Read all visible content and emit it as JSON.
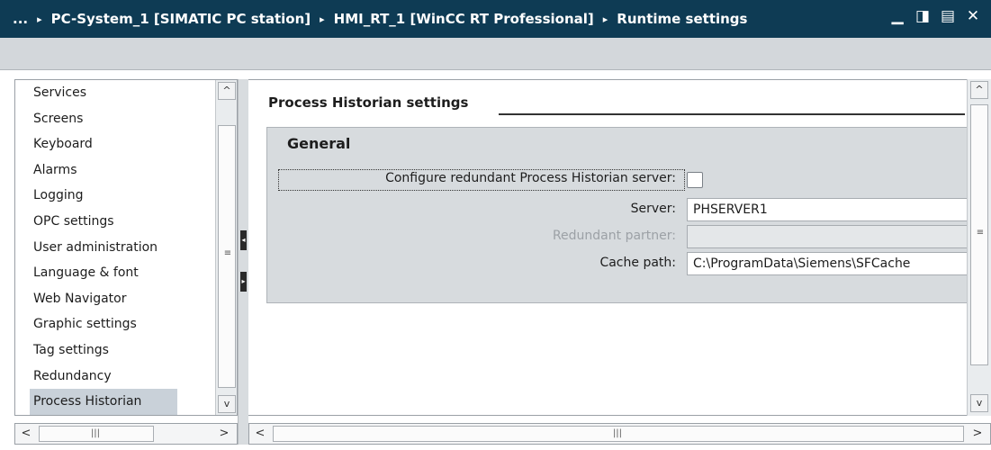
{
  "titlebar": {
    "prefix": "...",
    "crumbs": [
      "PC-System_1 [SIMATIC PC station]",
      "HMI_RT_1 [WinCC RT Professional]",
      "Runtime settings"
    ],
    "separator": "▸",
    "controls": [
      "▁",
      "◨",
      "▤",
      "✕"
    ]
  },
  "sidebar": {
    "items": [
      {
        "label": "Services"
      },
      {
        "label": "Screens"
      },
      {
        "label": "Keyboard"
      },
      {
        "label": "Alarms"
      },
      {
        "label": "Logging"
      },
      {
        "label": "OPC settings"
      },
      {
        "label": "User administration"
      },
      {
        "label": "Language & font"
      },
      {
        "label": "Web Navigator"
      },
      {
        "label": "Graphic settings"
      },
      {
        "label": "Tag settings"
      },
      {
        "label": "Redundancy"
      },
      {
        "label": "Process Historian",
        "selected": true
      }
    ]
  },
  "scroll_glyphs": {
    "up": "^",
    "down": "v",
    "left": "<",
    "right": ">",
    "grip_h": "|||",
    "grip_v": "≡"
  },
  "main": {
    "section_title": "Process Historian settings",
    "group_title": "General",
    "redundant_label": "Configure redundant Process Historian server:",
    "redundant_checked": false,
    "server_label": "Server:",
    "server_value": "PHSERVER1",
    "partner_label": "Redundant partner:",
    "partner_value": "",
    "cache_label": "Cache path:",
    "cache_value": "C:\\ProgramData\\Siemens\\SFCache"
  },
  "colors": {
    "titlebar_bg": "#0e3b54",
    "toolbar_bg": "#d3d7db",
    "group_bg": "#d7dbde",
    "selected_bg": "#c9d1d9"
  }
}
